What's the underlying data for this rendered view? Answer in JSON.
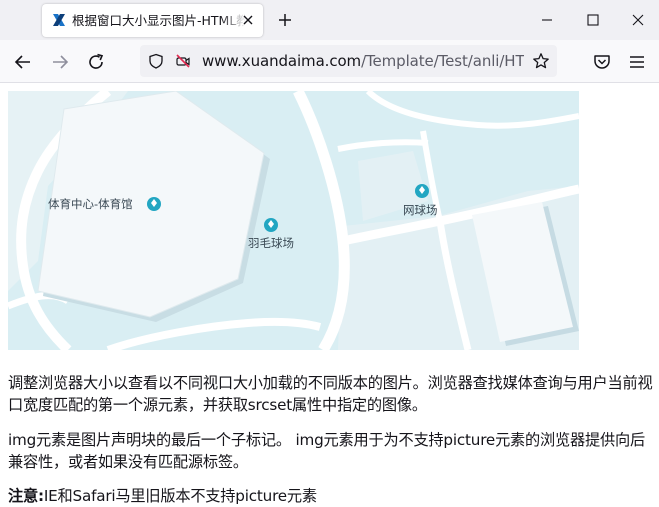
{
  "browser": {
    "tab": {
      "title": "根据窗口大小显示图片-HTML教程",
      "favicon": "xuandaima-logo-icon"
    },
    "url": {
      "host": "www.xuandaima.com",
      "path": "/Template/Test/anli/HTML_s"
    },
    "icons": [
      "close-icon",
      "plus-icon",
      "minimize-icon",
      "maximize-icon",
      "back-arrow-icon",
      "forward-arrow-icon",
      "reload-icon",
      "shield-icon",
      "camera-blocked-icon",
      "star-icon",
      "pocket-icon",
      "menu-icon"
    ]
  },
  "map": {
    "labels": {
      "sports_center": "体育中心-体育馆",
      "badminton": "羽毛球场",
      "tennis": "网球场"
    },
    "colors": {
      "water": "#d9eef3",
      "land": "#f4f8fa",
      "road": "#ffffff",
      "pin": "#22a6c2"
    }
  },
  "content": {
    "para1": "调整浏览器大小以查看以不同视口大小加载的不同版本的图片。浏览器查找媒体查询与用户当前视口宽度匹配的第一个源元素，并获取srcset属性中指定的图像。",
    "para2": "img元素是图片声明块的最后一个子标记。 img元素用于为不支持picture元素的浏览器提供向后兼容性，或者如果没有匹配源标签。",
    "note_label": "注意:",
    "note_text": "IE和Safari马里旧版本不支持picture元素"
  }
}
